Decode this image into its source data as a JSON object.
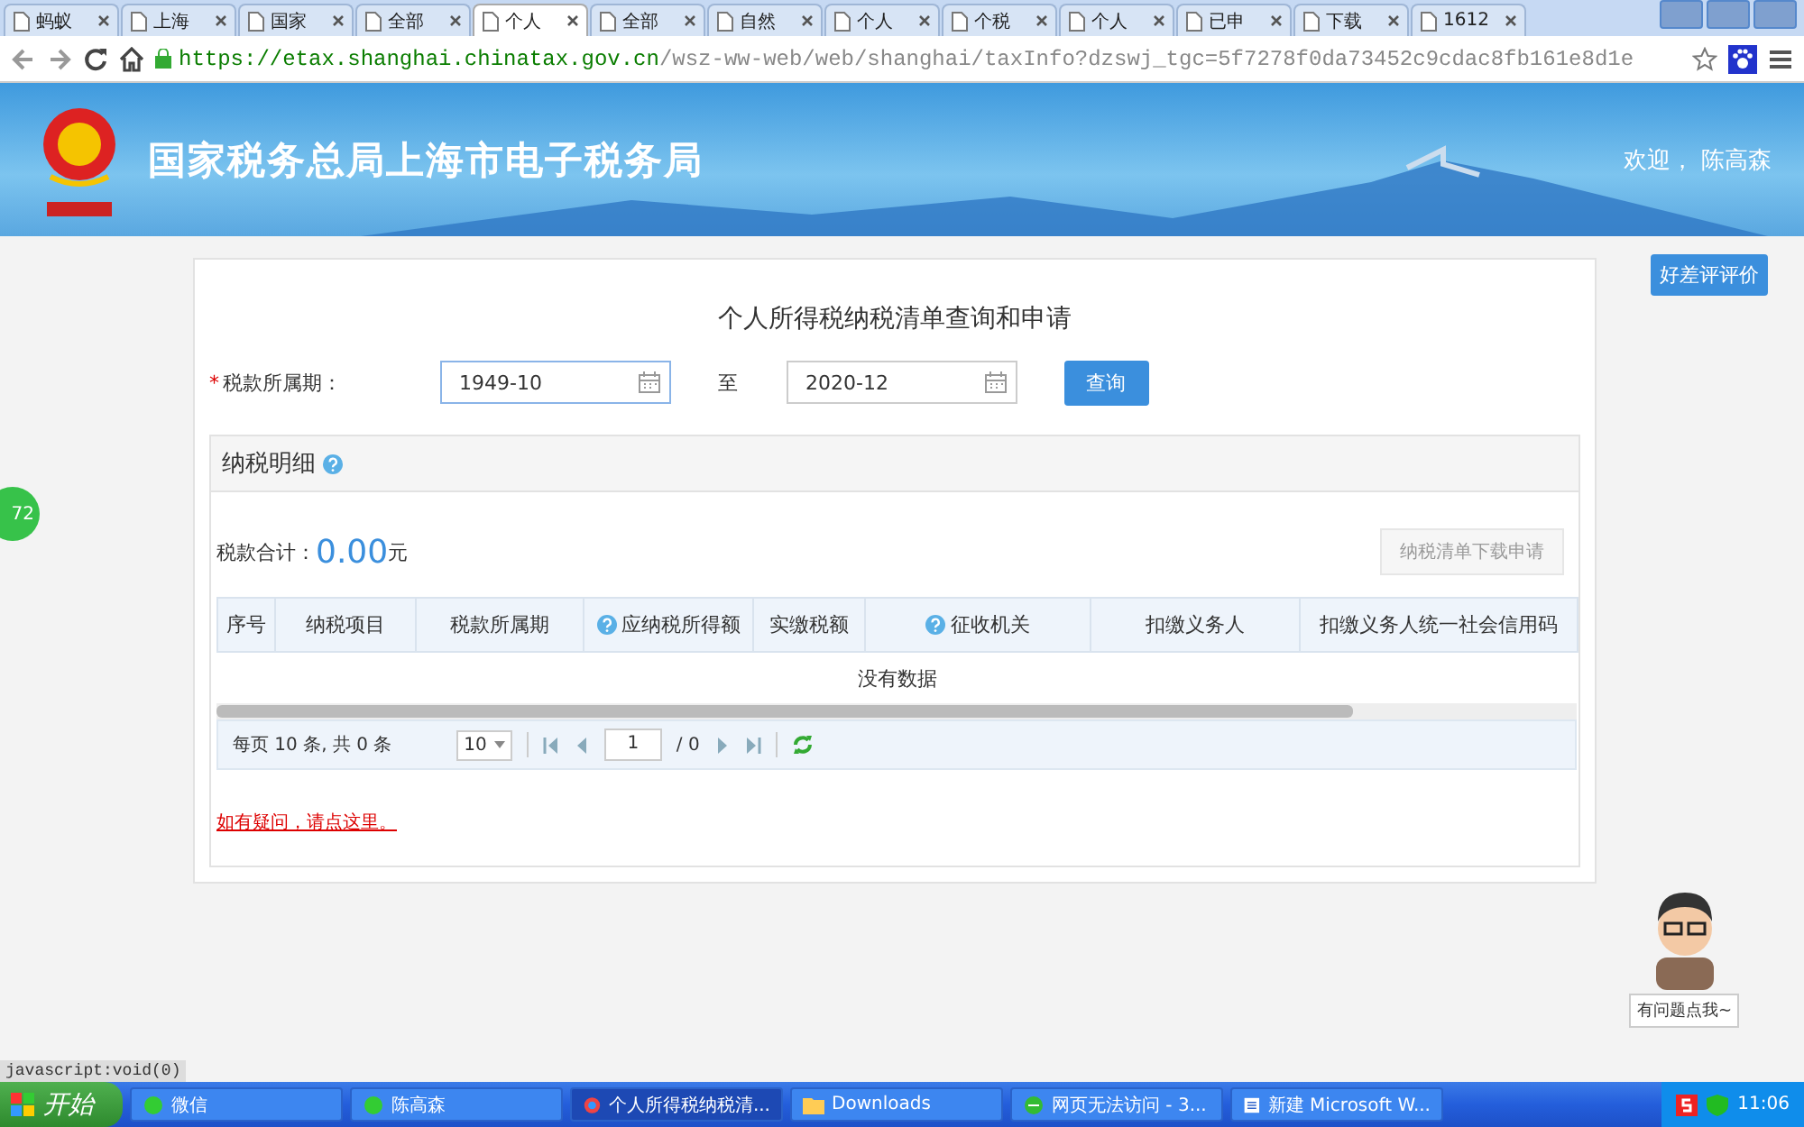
{
  "browser": {
    "tabs": [
      {
        "label": "蚂蚁",
        "selected": false
      },
      {
        "label": "上海",
        "selected": false
      },
      {
        "label": "国家",
        "selected": false
      },
      {
        "label": "全部",
        "selected": false
      },
      {
        "label": "个人",
        "selected": true
      },
      {
        "label": "全部",
        "selected": false
      },
      {
        "label": "自然",
        "selected": false
      },
      {
        "label": "个人",
        "selected": false
      },
      {
        "label": "个税",
        "selected": false
      },
      {
        "label": "个人",
        "selected": false
      },
      {
        "label": "已申",
        "selected": false
      },
      {
        "label": "下载",
        "selected": false
      },
      {
        "label": "1612",
        "selected": false
      }
    ],
    "url_host": "https://etax.shanghai.chinatax.gov.cn",
    "url_path": "/wsz-ww-web/web/shanghai/taxInfo?dzswj_tgc=5f7278f0da73452c9cdac8fb161e8d1e"
  },
  "banner": {
    "title": "国家税务总局上海市电子税务局",
    "welcome": "欢迎， 陈高森"
  },
  "rate_button": "好差评评价",
  "side_badge": "72",
  "form": {
    "title": "个人所得税纳税清单查询和申请",
    "required_mark": "*",
    "period_label": "税款所属期：",
    "start": "1949-10",
    "to": "至",
    "end": "2020-12",
    "query_button": "查询"
  },
  "detail": {
    "title": "纳税明细",
    "total_label": "税款合计：",
    "total_value": "0.00",
    "total_unit": "元",
    "apply_button": "纳税清单下载申请",
    "columns": [
      {
        "label": "序号",
        "help": false
      },
      {
        "label": "纳税项目",
        "help": false
      },
      {
        "label": "税款所属期",
        "help": false
      },
      {
        "label": "应纳税所得额",
        "help": true
      },
      {
        "label": "实缴税额",
        "help": false
      },
      {
        "label": "征收机关",
        "help": true
      },
      {
        "label": "扣缴义务人",
        "help": false
      },
      {
        "label": "扣缴义务人统一社会信用码",
        "help": false
      }
    ],
    "empty": "没有数据",
    "pager": {
      "summary": "每页 10 条, 共 0 条",
      "page_size": "10",
      "page": "1",
      "of": "/ 0"
    },
    "help_link": "如有疑问，请点这里。"
  },
  "assistant": {
    "bubble": "有问题点我~"
  },
  "status_text": "javascript:void(0)",
  "taskbar": {
    "start": "开始",
    "tasks": [
      {
        "label": "微信",
        "kind": "chat",
        "selected": false
      },
      {
        "label": "陈高森",
        "kind": "chat",
        "selected": false
      },
      {
        "label": "个人所得税纳税清...",
        "kind": "browser",
        "selected": true
      },
      {
        "label": "Downloads",
        "kind": "folder",
        "selected": false
      },
      {
        "label": "网页无法访问 - 3...",
        "kind": "ie",
        "selected": false
      },
      {
        "label": "新建 Microsoft W...",
        "kind": "doc",
        "selected": false
      }
    ],
    "time": "11:06"
  }
}
